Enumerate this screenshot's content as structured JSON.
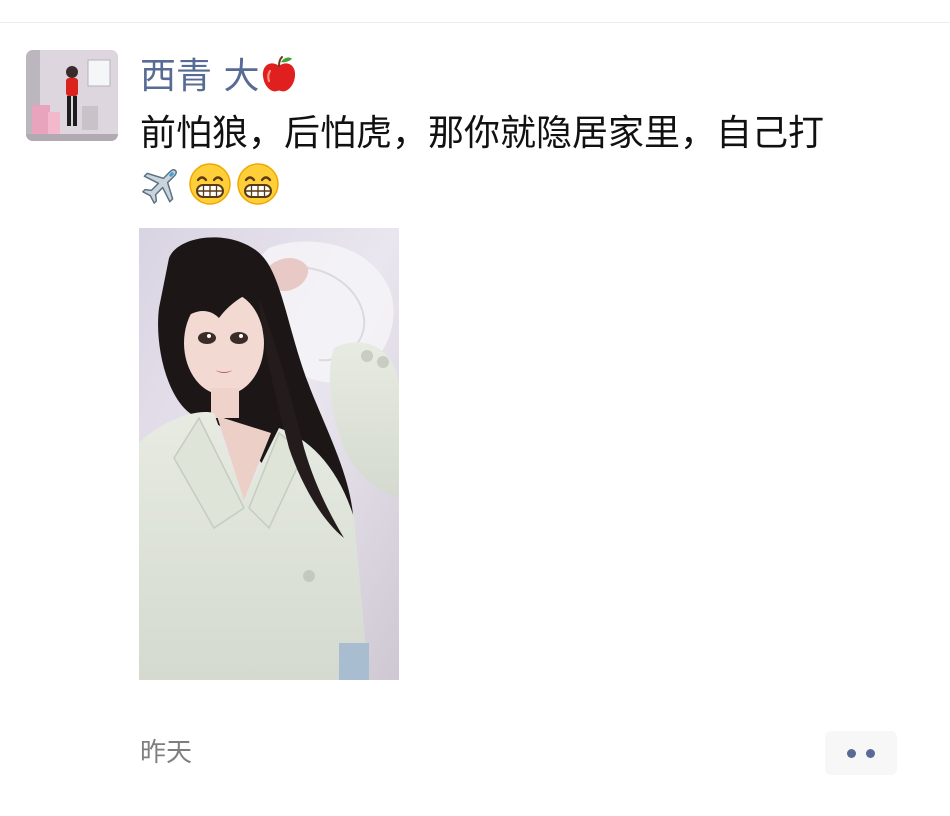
{
  "post": {
    "username": "西青 大",
    "username_emoji": "apple-icon",
    "text": "前怕狼，后怕虎，那你就隐居家里，自己打",
    "emojis": [
      "airplane-icon",
      "grinning-face-icon",
      "grinning-face-icon"
    ],
    "timestamp": "昨天"
  },
  "colors": {
    "username": "#576b95",
    "text": "#111111",
    "timestamp": "#7f7f7f",
    "more_button_bg": "#f7f7f7",
    "more_button_dots": "#576b95"
  }
}
